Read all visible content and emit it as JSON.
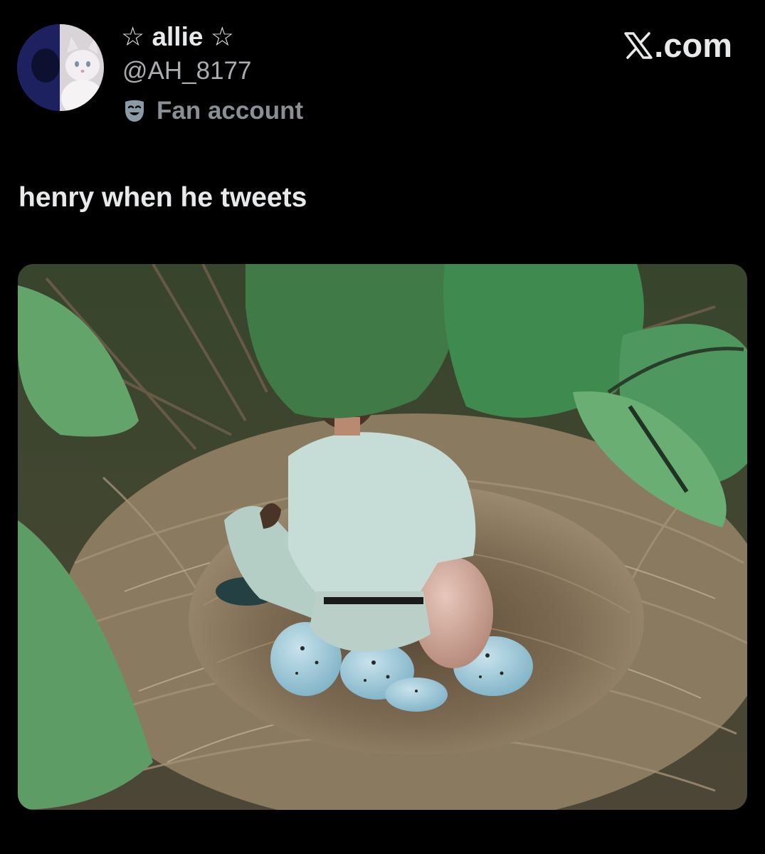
{
  "author": {
    "display_name": "☆ allie ☆",
    "handle": "@AH_8177",
    "affiliation": "Fan account",
    "affiliation_icon": "theater-mask-icon",
    "avatar_icon": "cat-avatar-icon"
  },
  "site": {
    "label": ".com",
    "logo_icon": "x-logo-icon"
  },
  "tweet": {
    "text": "henry when he tweets"
  },
  "media": {
    "kind": "photo",
    "depicts": "man-in-bird-nest-photo"
  },
  "colors": {
    "background": "#000000",
    "primary_text": "#e7e9ea",
    "secondary_text": "#a9adb2",
    "affiliation_text": "#8a8f95"
  }
}
